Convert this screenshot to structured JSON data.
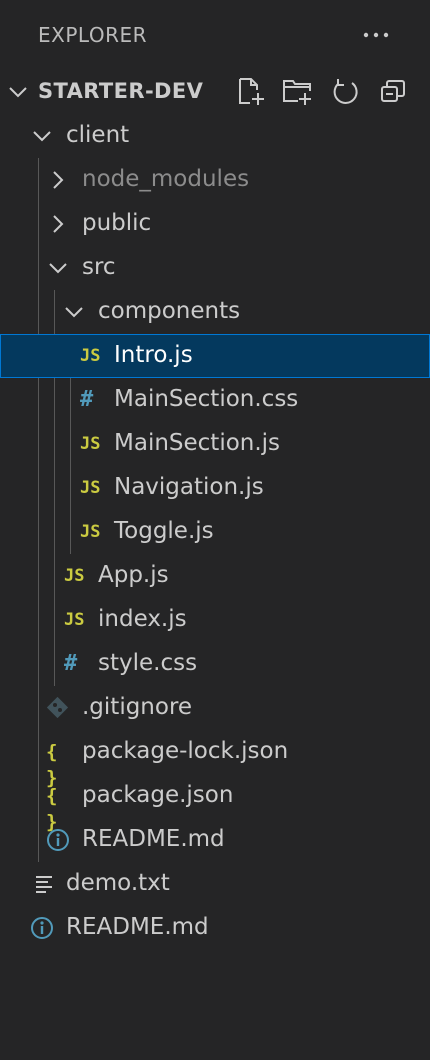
{
  "header": {
    "title": "EXPLORER",
    "more_icon": "ellipsis-icon"
  },
  "section": {
    "name": "STARTER-DEV",
    "actions": [
      "new-file-icon",
      "new-folder-icon",
      "refresh-icon",
      "collapse-all-icon"
    ]
  },
  "tree": [
    {
      "label": "client",
      "kind": "folder",
      "expanded": true,
      "depth": 1
    },
    {
      "label": "node_modules",
      "kind": "folder",
      "expanded": false,
      "depth": 2,
      "dimmed": true
    },
    {
      "label": "public",
      "kind": "folder",
      "expanded": false,
      "depth": 2
    },
    {
      "label": "src",
      "kind": "folder",
      "expanded": true,
      "depth": 2
    },
    {
      "label": "components",
      "kind": "folder",
      "expanded": true,
      "depth": 3
    },
    {
      "label": "Intro.js",
      "kind": "js",
      "icon": "JS",
      "depth": 4,
      "selected": true
    },
    {
      "label": "MainSection.css",
      "kind": "css",
      "icon": "#",
      "depth": 4
    },
    {
      "label": "MainSection.js",
      "kind": "js",
      "icon": "JS",
      "depth": 4
    },
    {
      "label": "Navigation.js",
      "kind": "js",
      "icon": "JS",
      "depth": 4
    },
    {
      "label": "Toggle.js",
      "kind": "js",
      "icon": "JS",
      "depth": 4
    },
    {
      "label": "App.js",
      "kind": "js",
      "icon": "JS",
      "depth": 3
    },
    {
      "label": "index.js",
      "kind": "js",
      "icon": "JS",
      "depth": 3
    },
    {
      "label": "style.css",
      "kind": "css",
      "icon": "#",
      "depth": 3
    },
    {
      "label": ".gitignore",
      "kind": "git",
      "depth": 2
    },
    {
      "label": "package-lock.json",
      "kind": "json",
      "icon": "{ }",
      "depth": 2
    },
    {
      "label": "package.json",
      "kind": "json",
      "icon": "{ }",
      "depth": 2
    },
    {
      "label": "README.md",
      "kind": "info",
      "depth": 2
    },
    {
      "label": "demo.txt",
      "kind": "text",
      "depth": 1
    },
    {
      "label": "README.md",
      "kind": "info",
      "depth": 1
    }
  ],
  "colors": {
    "background": "#252526",
    "selection": "#04395e",
    "selection_border": "#0078d4",
    "js_icon": "#cbcb41",
    "css_icon": "#519aba"
  }
}
